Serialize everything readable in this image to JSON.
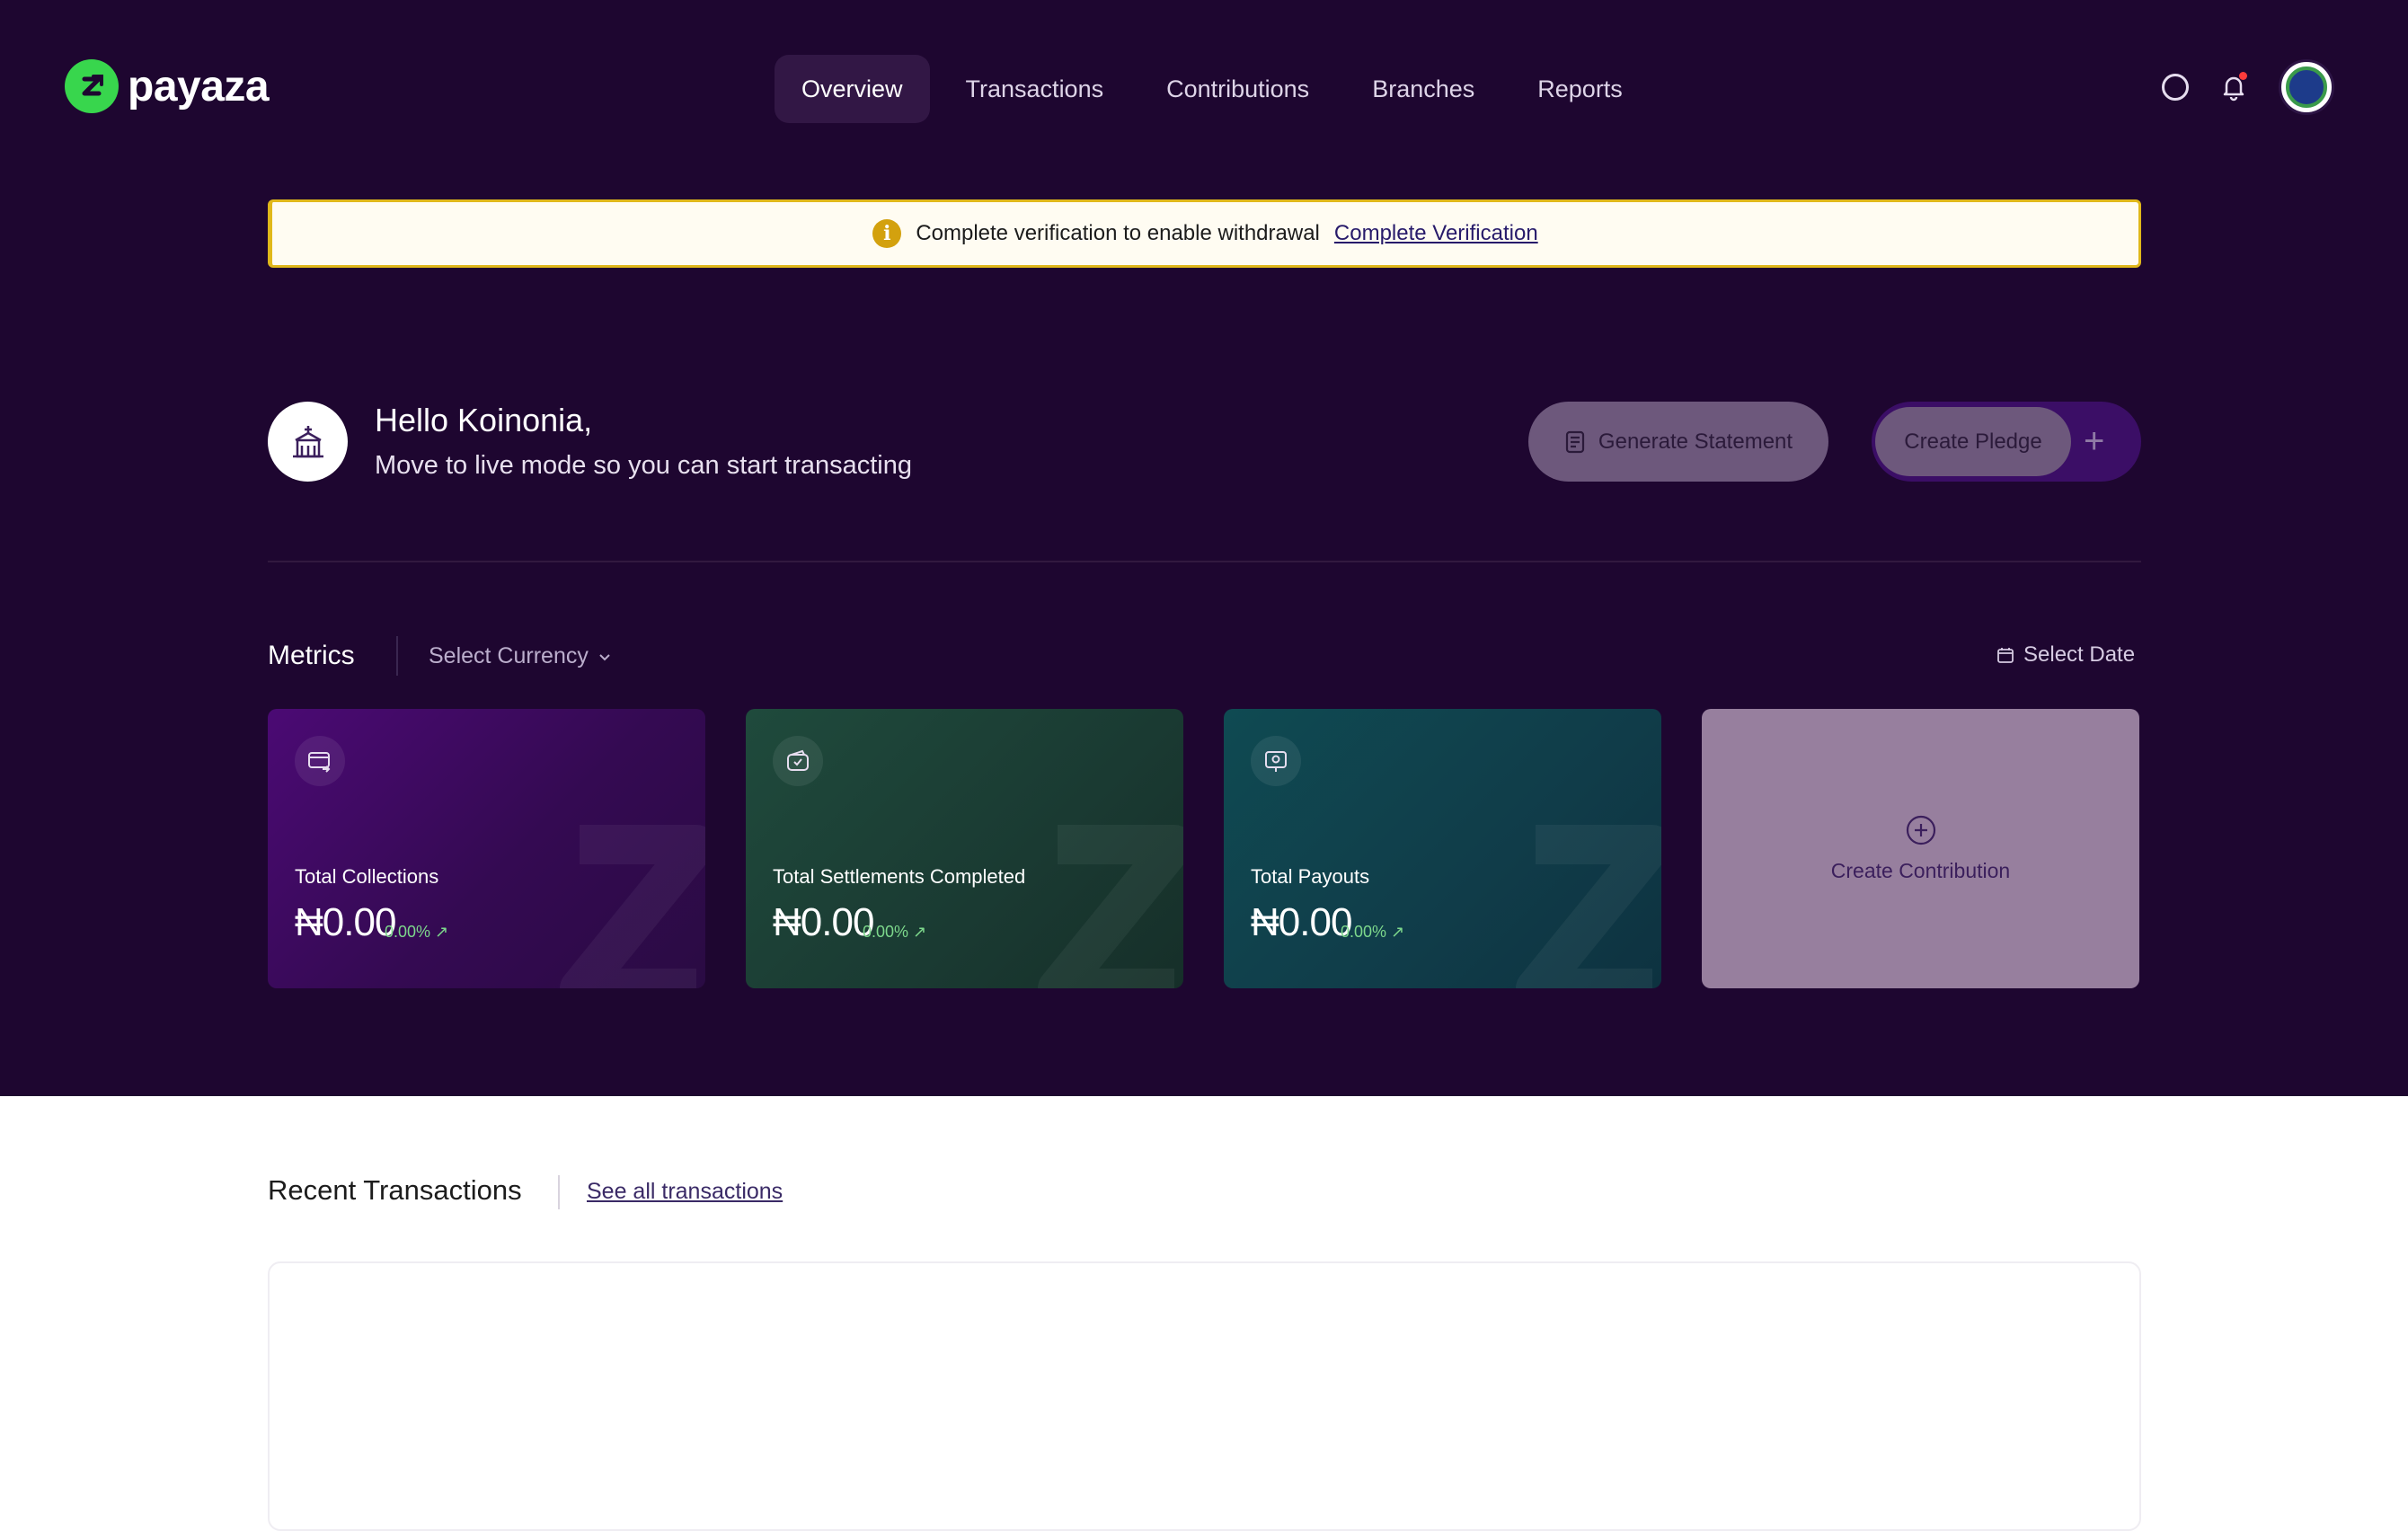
{
  "brand": {
    "name": "payaza",
    "accent": "#38d64d"
  },
  "nav": {
    "items": [
      {
        "label": "Overview",
        "active": true
      },
      {
        "label": "Transactions"
      },
      {
        "label": "Contributions"
      },
      {
        "label": "Branches"
      },
      {
        "label": "Reports"
      }
    ]
  },
  "header_icons": [
    "help-circle-icon",
    "bell-icon",
    "org-avatar"
  ],
  "banner": {
    "text": "Complete verification to enable withdrawal",
    "link": "Complete Verification",
    "icon": "info-icon"
  },
  "greeting": {
    "title": "Hello Koinonia,",
    "subtitle": "Move to live mode so you can start transacting"
  },
  "actions": {
    "generate_statement": "Generate Statement",
    "create_pledge": "Create Pledge",
    "plus": "+"
  },
  "metrics": {
    "title": "Metrics",
    "currency_select": "Select Currency",
    "select_date": "Select Date",
    "cards": [
      {
        "label": "Total Collections",
        "value": "₦0.00",
        "change": "0.00%",
        "icon": "card-transfer-icon"
      },
      {
        "label": "Total Settlements Completed",
        "value": "₦0.00",
        "change": "0.00%",
        "icon": "wallet-check-icon"
      },
      {
        "label": "Total Payouts",
        "value": "₦0.00",
        "change": "0.00%",
        "icon": "payout-icon"
      }
    ],
    "create_contribution": "Create Contribution"
  },
  "recent": {
    "title": "Recent Transactions",
    "link": "See all transactions"
  }
}
